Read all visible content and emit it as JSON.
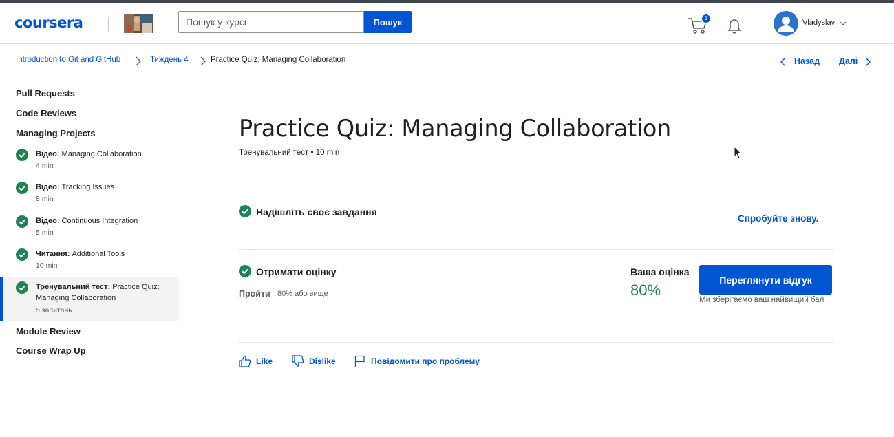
{
  "header": {
    "logo": "coursera",
    "search": {
      "placeholder": "Пошук у курсі",
      "button": "Пошук"
    },
    "cart": {
      "icon": "cart-icon",
      "badge": "1"
    },
    "notifications_icon": "bell-icon",
    "user": {
      "name": "Vladyslav",
      "icon": "avatar-icon"
    }
  },
  "breadcrumb": {
    "items": [
      "Introduction to Git and GitHub",
      "Тиждень 4",
      "Practice Quiz: Managing Collaboration"
    ]
  },
  "nav": {
    "prev": "Назад",
    "next": "Далі"
  },
  "sidebar": {
    "sections_top": [
      "Pull Requests",
      "Code Reviews",
      "Managing Projects"
    ],
    "items": [
      {
        "type": "Відео:",
        "name": "Managing Collaboration",
        "meta": "4 min",
        "done": true
      },
      {
        "type": "Відео:",
        "name": "Tracking Issues",
        "meta": "8 min",
        "done": true
      },
      {
        "type": "Відео:",
        "name": "Continuous Integration",
        "meta": "5 min",
        "done": true
      },
      {
        "type": "Читання:",
        "name": "Additional Tools",
        "meta": "10 min",
        "done": true
      },
      {
        "type": "Тренувальний тест:",
        "name": "Practice Quiz: Managing Collaboration",
        "meta": "5 запитань",
        "done": true,
        "active": true
      }
    ],
    "sections_bottom": [
      "Module Review",
      "Course Wrap Up"
    ]
  },
  "main": {
    "title": "Practice Quiz: Managing Collaboration",
    "subtitle": "Тренувальний тест • 10 min",
    "submit_step": {
      "title": "Надішліть своє завдання",
      "retry": "Спробуйте знову."
    },
    "grade_step": {
      "title": "Отримати оцінку",
      "pass_label": "Пройти",
      "pass_value": "80% або вище",
      "your_grade_label": "Ваша оцінка",
      "your_grade_value": "80%",
      "feedback_button": "Переглянути відгук",
      "keep_note": "Ми зберігаємо ваш найвищий бал"
    },
    "actions": {
      "like": "Like",
      "dislike": "Dislike",
      "report": "Повідомити про проблему"
    }
  },
  "colors": {
    "accent": "#0056d2",
    "success": "#1f8354",
    "text": "#1f1f1f",
    "muted": "#5b5b5b"
  }
}
